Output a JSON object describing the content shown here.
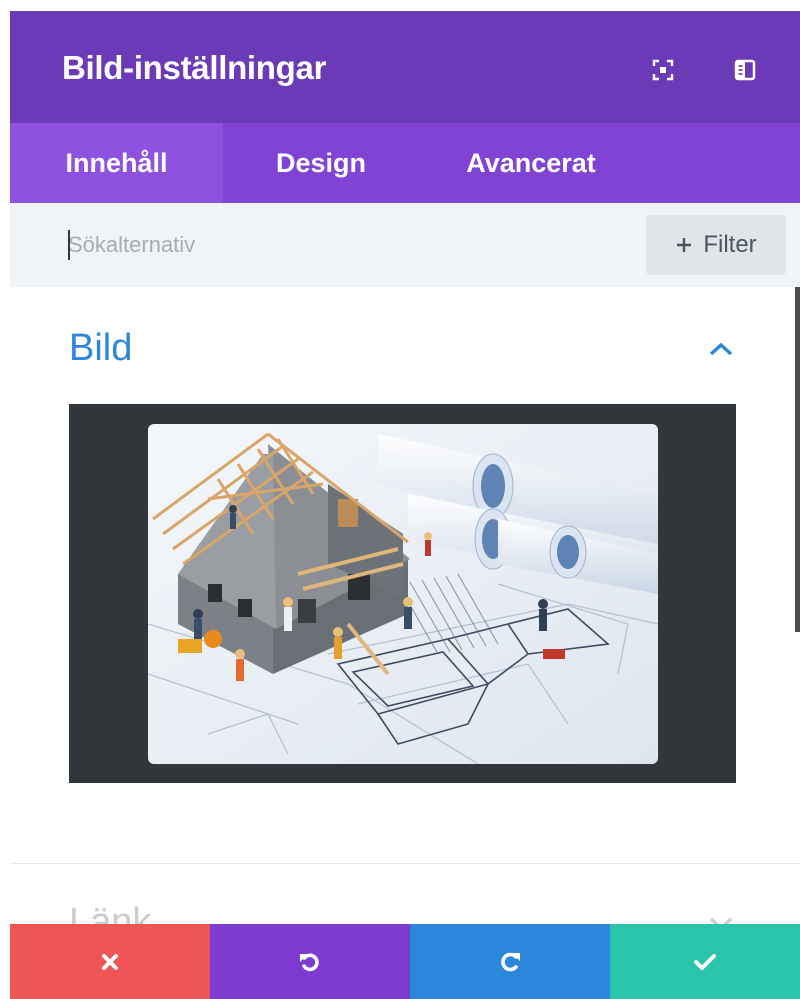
{
  "header": {
    "title": "Bild-inställningar",
    "icons": [
      "fullscreen-icon",
      "sidebar-layout-icon"
    ]
  },
  "tabs": [
    {
      "label": "Innehåll",
      "active": true
    },
    {
      "label": "Design",
      "active": false
    },
    {
      "label": "Avancerat",
      "active": false
    }
  ],
  "search": {
    "placeholder": "Sökalternativ",
    "value": "",
    "filter_label": "Filter",
    "filter_icon": "plus-icon"
  },
  "sections": [
    {
      "title": "Bild",
      "expanded": true,
      "toggle_icon": "chevron-up-icon",
      "image_alt": "Miniature construction workers building a house on blueprints"
    },
    {
      "title": "Länk",
      "expanded": false,
      "toggle_icon": "chevron-down-icon"
    }
  ],
  "footer": {
    "buttons": [
      {
        "name": "cancel",
        "icon": "close-icon",
        "color": "#ef5555"
      },
      {
        "name": "undo",
        "icon": "undo-icon",
        "color": "#7d3bcf"
      },
      {
        "name": "redo",
        "icon": "redo-icon",
        "color": "#2b87da"
      },
      {
        "name": "save",
        "icon": "check-icon",
        "color": "#29c4a9"
      }
    ]
  },
  "colors": {
    "header": "#6b3ab7",
    "tabs": "#8043d4",
    "active_tab": "#8f52e0",
    "accent": "#2b87da",
    "image_box": "#32373c"
  }
}
